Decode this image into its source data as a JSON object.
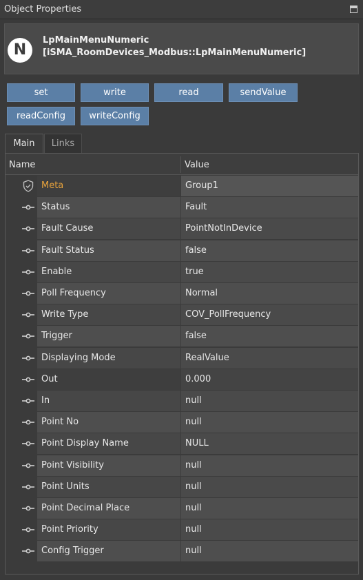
{
  "panel": {
    "title": "Object Properties"
  },
  "header": {
    "logo_letter": "N",
    "name": "LpMainMenuNumeric",
    "path": "[iSMA_RoomDevices_Modbus::LpMainMenuNumeric]"
  },
  "actions": [
    {
      "label": "set"
    },
    {
      "label": "write"
    },
    {
      "label": "read"
    },
    {
      "label": "sendValue"
    },
    {
      "label": "readConfig"
    },
    {
      "label": "writeConfig"
    }
  ],
  "tabs": [
    {
      "label": "Main",
      "active": true
    },
    {
      "label": "Links",
      "active": false
    }
  ],
  "table": {
    "columns": {
      "name": "Name",
      "value": "Value"
    },
    "rows": [
      {
        "name": "Meta",
        "value": "Group1",
        "icon": "shield-icon"
      },
      {
        "name": "Status",
        "value": "Fault",
        "icon": "slot-icon"
      },
      {
        "name": "Fault Cause",
        "value": "PointNotInDevice",
        "icon": "slot-icon"
      },
      {
        "name": "Fault Status",
        "value": "false",
        "icon": "slot-icon"
      },
      {
        "name": "Enable",
        "value": "true",
        "icon": "slot-icon"
      },
      {
        "name": "Poll Frequency",
        "value": "Normal",
        "icon": "slot-icon"
      },
      {
        "name": "Write Type",
        "value": "COV_PollFrequency",
        "icon": "slot-icon"
      },
      {
        "name": "Trigger",
        "value": "false",
        "icon": "slot-icon"
      },
      {
        "name": "Displaying Mode",
        "value": "RealValue",
        "icon": "slot-icon"
      },
      {
        "name": "Out",
        "value": "0.000",
        "icon": "slot-icon"
      },
      {
        "name": "In",
        "value": "null",
        "icon": "slot-icon"
      },
      {
        "name": "Point No",
        "value": "null",
        "icon": "slot-icon"
      },
      {
        "name": "Point Display Name",
        "value": "NULL",
        "icon": "slot-icon"
      },
      {
        "name": "Point Visibility",
        "value": "null",
        "icon": "slot-icon"
      },
      {
        "name": "Point Units",
        "value": "null",
        "icon": "slot-icon"
      },
      {
        "name": "Point Decimal Place",
        "value": "null",
        "icon": "slot-icon"
      },
      {
        "name": "Point Priority",
        "value": "null",
        "icon": "slot-icon"
      },
      {
        "name": "Config Trigger",
        "value": "null",
        "icon": "slot-icon"
      }
    ]
  },
  "colors": {
    "button_bg": "#5b7fa6",
    "meta_label": "#e6a23c",
    "panel_bg": "#3a3a3a"
  }
}
